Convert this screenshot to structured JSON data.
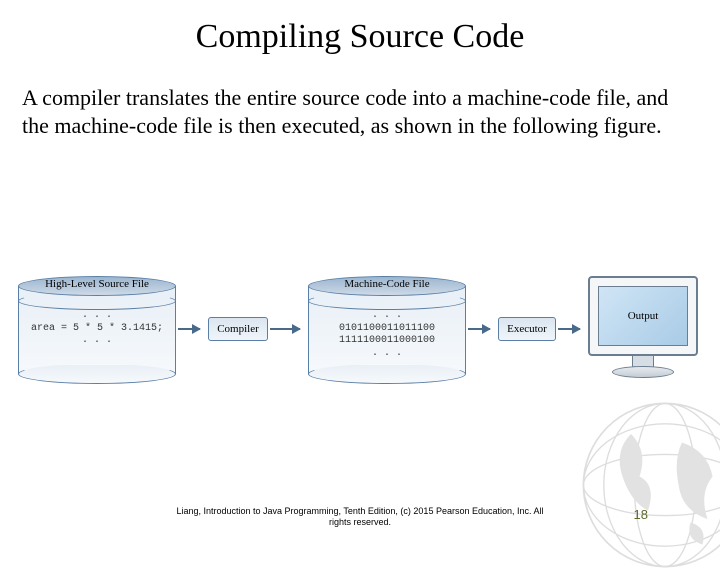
{
  "title": "Compiling Source Code",
  "body": "A compiler translates the entire source code into a machine-code file, and the machine-code file is then executed, as shown in the following figure.",
  "diagram": {
    "source_file": {
      "title": "High-Level Source File",
      "dots": ". . .",
      "code": "area = 5 * 5 * 3.1415;"
    },
    "compiler": {
      "label": "Compiler"
    },
    "machine_file": {
      "title": "Machine-Code File",
      "dots": ". . .",
      "line1": "0101100011011100",
      "line2": "1111100011000100"
    },
    "executor": {
      "label": "Executor"
    },
    "output": {
      "label": "Output"
    }
  },
  "footer_line1": "Liang, Introduction to Java Programming, Tenth Edition, (c) 2015 Pearson Education, Inc. All",
  "footer_line2": "rights reserved.",
  "page_number": "18"
}
